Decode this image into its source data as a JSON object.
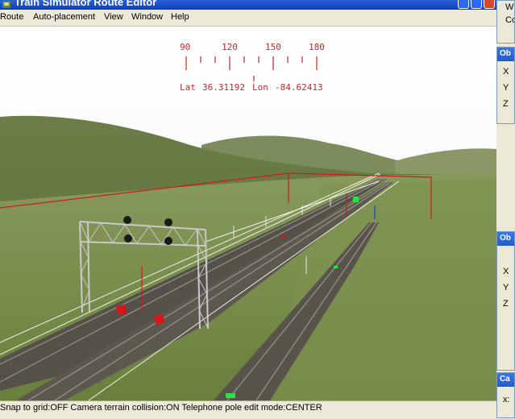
{
  "window": {
    "title": "Train Simulator Route Editor"
  },
  "menu": {
    "items": [
      "Route",
      "Auto-placement",
      "View",
      "Window",
      "Help"
    ]
  },
  "compass": {
    "ticks": [
      "90",
      "120",
      "150",
      "180"
    ],
    "position_prefix": "Lat",
    "lat": "36.31192",
    "lon_prefix": "Lon",
    "lon": "-84.62413"
  },
  "status": {
    "text": "Snap to grid:OFF Camera terrain collision:ON Telephone pole edit mode:CENTER"
  },
  "panels": {
    "top": {
      "rows": [
        "W",
        "Co"
      ]
    },
    "object1": {
      "title": "Ob",
      "rows": [
        "X",
        "Y",
        "Z"
      ]
    },
    "object2": {
      "title": "Ob",
      "rows": [
        "X",
        "Y",
        "Z"
      ]
    },
    "camera": {
      "title": "Ca",
      "rows": [
        "x:"
      ]
    }
  },
  "colors": {
    "titlebar": "#0a3fb8",
    "sky": "#ffffff",
    "terrain": "#6e8240",
    "wire": "#cc1b1b",
    "ruler": "#c0282a"
  }
}
